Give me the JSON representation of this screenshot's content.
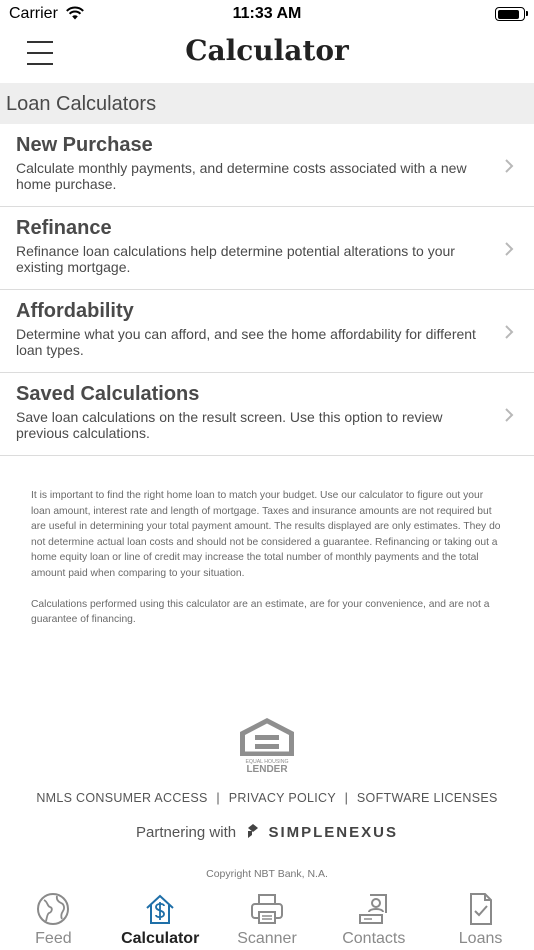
{
  "status_bar": {
    "carrier": "Carrier",
    "time": "11:33 AM",
    "battery_level": 0.9
  },
  "nav": {
    "title": "Calculator"
  },
  "section": {
    "header": "Loan Calculators"
  },
  "calculators": [
    {
      "title": "New Purchase",
      "description": "Calculate monthly payments, and determine costs associated with a new home purchase."
    },
    {
      "title": "Refinance",
      "description": "Refinance loan calculations help determine potential alterations to your existing mortgage."
    },
    {
      "title": "Affordability",
      "description": "Determine what you can afford, and see the home affordability for different loan types."
    },
    {
      "title": "Saved Calculations",
      "description": "Save loan calculations on the result screen. Use this option to review previous calculations."
    }
  ],
  "disclaimer": {
    "paragraph1": "It is important to find the right home loan to match your budget. Use our calculator to figure out your loan amount, interest rate and length of mortgage. Taxes and insurance amounts are not required but are useful in determining your total payment amount. The results displayed are only estimates. They do not determine actual loan costs and should not be considered a guarantee. Refinancing or taking out a home equity loan or line of credit may increase the total number of monthly payments and the total amount paid when comparing to your situation.",
    "paragraph2": "Calculations performed using this calculator are an estimate, are for your convenience, and are not a guarantee of financing."
  },
  "footer": {
    "logo_text_top": "EQUAL HOUSING",
    "logo_text_bottom": "LENDER",
    "links": [
      "NMLS CONSUMER ACCESS",
      "PRIVACY POLICY",
      "SOFTWARE LICENSES"
    ],
    "separator": "|",
    "partner_prefix": "Partnering with",
    "partner_brand": "SIMPLENEXUS",
    "copyright": "Copyright NBT Bank, N.A."
  },
  "tabs": [
    {
      "label": "Feed",
      "icon": "globe-icon",
      "active": false
    },
    {
      "label": "Calculator",
      "icon": "house-dollar-icon",
      "active": true
    },
    {
      "label": "Scanner",
      "icon": "printer-icon",
      "active": false
    },
    {
      "label": "Contacts",
      "icon": "contacts-icon",
      "active": false
    },
    {
      "label": "Loans",
      "icon": "document-check-icon",
      "active": false
    }
  ],
  "colors": {
    "accent": "#1f6fa8",
    "inactive_tab": "#8a8a8a",
    "section_bg": "#eeeeee"
  }
}
